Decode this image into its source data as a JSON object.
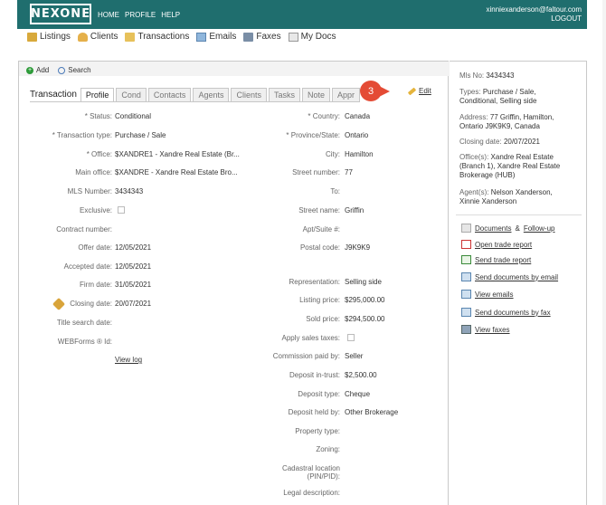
{
  "header": {
    "logo": "NEXONE",
    "nav": [
      "HOME",
      "PROFILE",
      "HELP"
    ],
    "user_email": "xinniexanderson@faltour.com",
    "logout": "LOGOUT",
    "bg_color": "#1f6e6e"
  },
  "main_nav": [
    {
      "label": "Listings",
      "icon": "house-icon"
    },
    {
      "label": "Clients",
      "icon": "clients-icon"
    },
    {
      "label": "Transactions",
      "icon": "folder-icon"
    },
    {
      "label": "Emails",
      "icon": "envelope-icon"
    },
    {
      "label": "Faxes",
      "icon": "fax-icon"
    },
    {
      "label": "My Docs",
      "icon": "document-icon"
    }
  ],
  "toolbar": {
    "add": "Add",
    "search": "Search"
  },
  "tabs": {
    "title": "Transaction",
    "items": [
      "Profile",
      "Cond",
      "Contacts",
      "Agents",
      "Clients",
      "Tasks",
      "Note",
      "Appr"
    ],
    "active": "Profile"
  },
  "callout": {
    "number": "3",
    "color": "#e44b35"
  },
  "edit_label": "Edit",
  "form_left": {
    "status_label": "* Status:",
    "status": "Conditional",
    "ttype_label": "* Transaction type:",
    "ttype": "Purchase / Sale",
    "office_label": "* Office:",
    "office": "$XANDRE1 - Xandre Real Estate (Br...",
    "main_office_label": "Main office:",
    "main_office": "$XANDRE - Xandre Real Estate Bro...",
    "mls_label": "MLS Number:",
    "mls": "3434343",
    "exclusive_label": "Exclusive:",
    "contract_label": "Contract number:",
    "offer_label": "Offer date:",
    "offer": "12/05/2021",
    "accepted_label": "Accepted date:",
    "accepted": "12/05/2021",
    "firm_label": "Firm date:",
    "firm": "31/05/2021",
    "closing_label": "Closing date:",
    "closing": "20/07/2021",
    "title_search_label": "Title search date:",
    "webforms_label": "WEBForms ® Id:",
    "view_log": "View log"
  },
  "form_right": {
    "country_label": "* Country:",
    "country": "Canada",
    "province_label": "* Province/State:",
    "province": "Ontario",
    "city_label": "City:",
    "city": "Hamilton",
    "street_number_label": "Street number:",
    "street_number": "77",
    "to_label": "To:",
    "street_name_label": "Street name:",
    "street_name": "Griffin",
    "apt_label": "Apt/Suite #:",
    "postal_label": "Postal code:",
    "postal": "J9K9K9",
    "representation_label": "Representation:",
    "representation": "Selling side",
    "listing_price_label": "Listing price:",
    "listing_price": "$295,000.00",
    "sold_price_label": "Sold price:",
    "sold_price": "$294,500.00",
    "sales_taxes_label": "Apply sales taxes:",
    "commission_label": "Commission paid by:",
    "commission": "Seller",
    "deposit_trust_label": "Deposit in-trust:",
    "deposit_trust": "$2,500.00",
    "deposit_type_label": "Deposit type:",
    "deposit_type": "Cheque",
    "deposit_held_label": "Deposit held by:",
    "deposit_held": "Other Brokerage",
    "property_type_label": "Property type:",
    "zoning_label": "Zoning:",
    "cadastral_label_1": "Cadastral location",
    "cadastral_label_2": "(PIN/PID):",
    "legal_label": "Legal description:"
  },
  "sidebar": {
    "mls_label": "Mls No:",
    "mls": "3434343",
    "types_label": "Types:",
    "types_1": "Purchase / Sale,",
    "types_2": "Conditional, Selling side",
    "address_label": "Address:",
    "address_1": "77 Griffin, Hamilton,",
    "address_2": "Ontario J9K9K9, Canada",
    "closing_label": "Closing date:",
    "closing": "20/07/2021",
    "offices_label": "Office(s):",
    "offices_1": "Xandre Real Estate",
    "offices_2": "(Branch 1), Xandre Real Estate",
    "offices_3": "Brokerage (HUB)",
    "agents_label": "Agent(s):",
    "agents_1": "Nelson Xanderson,",
    "agents_2": "Xinnie Xanderson",
    "links": {
      "documents": "Documents",
      "amp": "&",
      "followup": "Follow-up",
      "open_trade": "Open trade report",
      "send_trade": "Send trade report",
      "send_docs_email": "Send documents by email",
      "view_emails": "View emails",
      "send_docs_fax": "Send documents by fax",
      "view_faxes": "View faxes"
    }
  }
}
